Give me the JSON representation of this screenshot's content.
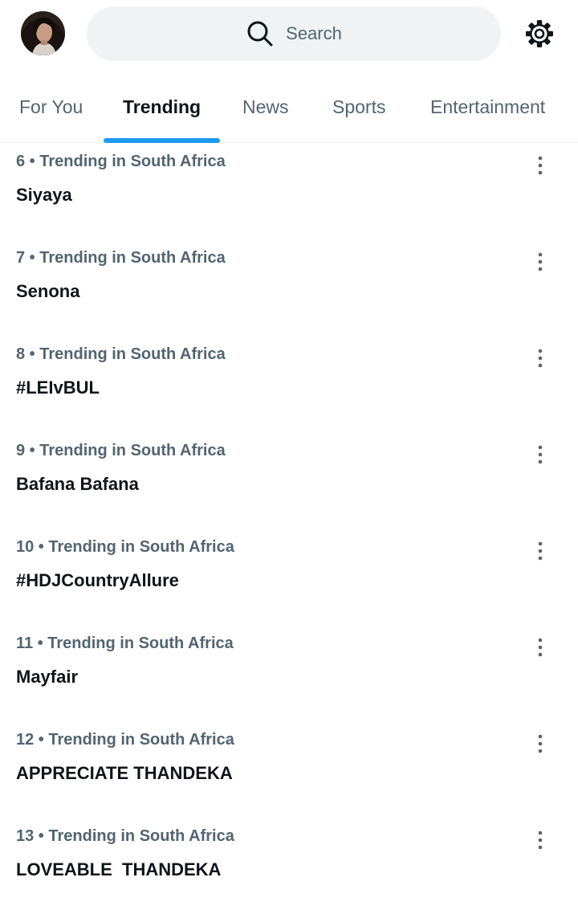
{
  "header": {
    "search_placeholder": "Search",
    "search_icon": "search-icon",
    "settings_icon": "gear-icon"
  },
  "tabs": [
    {
      "label": "For You",
      "active": false
    },
    {
      "label": "Trending",
      "active": true
    },
    {
      "label": "News",
      "active": false
    },
    {
      "label": "Sports",
      "active": false
    },
    {
      "label": "Entertainment",
      "active": false
    }
  ],
  "trends": [
    {
      "meta": "6 • Trending in South Africa",
      "name": "Siyaya"
    },
    {
      "meta": "7 • Trending in South Africa",
      "name": "Senona"
    },
    {
      "meta": "8 • Trending in South Africa",
      "name": "#LEIvBUL"
    },
    {
      "meta": "9 • Trending in South Africa",
      "name": "Bafana Bafana"
    },
    {
      "meta": "10 • Trending in South Africa",
      "name": "#HDJCountryAllure"
    },
    {
      "meta": "11 • Trending in South Africa",
      "name": "Mayfair"
    },
    {
      "meta": "12 • Trending in South Africa",
      "name": "APPRECIATE THANDEKA"
    },
    {
      "meta": "13 • Trending in South Africa",
      "name": "LOVEABLE  THANDEKA"
    }
  ],
  "colors": {
    "accent": "#1d9bf0",
    "secondary_text": "#536471",
    "primary_text": "#0f1419",
    "search_bg": "#eff3f4"
  }
}
